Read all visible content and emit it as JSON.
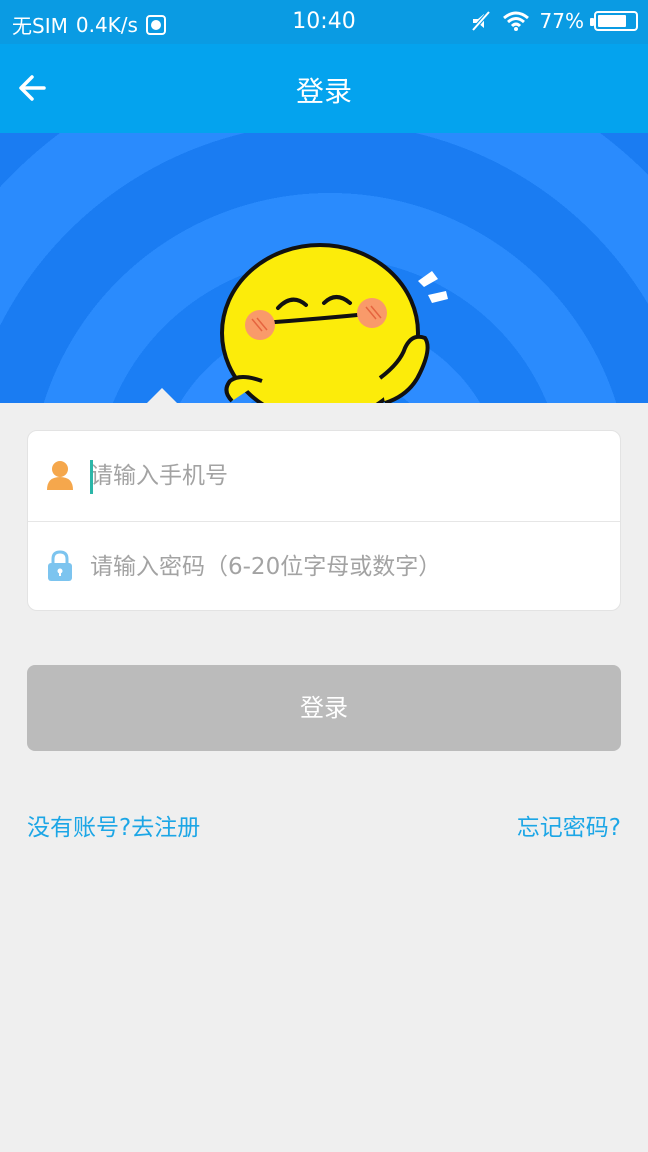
{
  "status_bar": {
    "carrier": "无SIM",
    "speed": "0.4K/s",
    "time": "10:40",
    "battery": "77%",
    "battery_level": 0.77
  },
  "nav": {
    "title": "登录"
  },
  "form": {
    "phone_placeholder": "请输入手机号",
    "password_placeholder": "请输入密码（6-20位字母或数字）"
  },
  "login_button": "登录",
  "links": {
    "register": "没有账号?去注册",
    "forgot": "忘记密码?"
  },
  "colors": {
    "status_bar": "#0a9be3",
    "nav_bar": "#04a3ee",
    "banner": "#1a7ff5",
    "accent_link": "#1ca6e6",
    "button_disabled": "#bbbbbb",
    "user_icon": "#f5a74c",
    "lock_icon": "#7cc4ef"
  },
  "icons": [
    "arrow-left-icon",
    "user-icon",
    "lock-icon",
    "sim-app-icon",
    "mute-icon",
    "wifi-icon",
    "battery-icon"
  ]
}
